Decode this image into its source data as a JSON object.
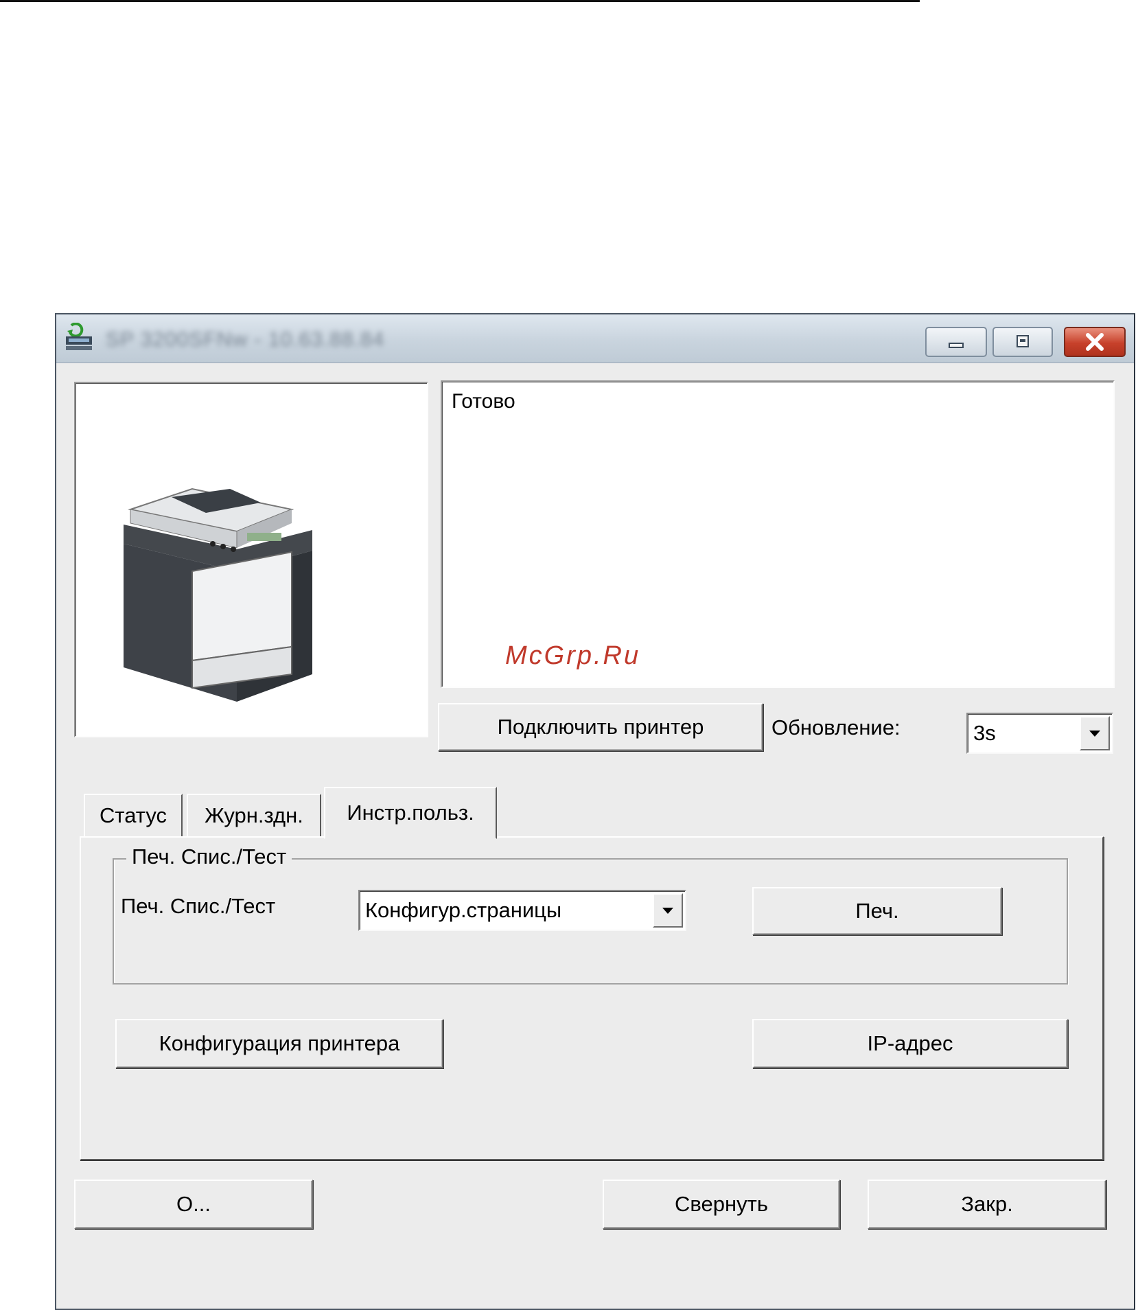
{
  "window": {
    "title": "SP 3200SFNw - 10.63.88.84",
    "title_blurred": true
  },
  "status": {
    "text": "Готово",
    "watermark": "McGrp.Ru"
  },
  "connect_button": "Подключить принтер",
  "update": {
    "label": "Обновление:",
    "value": "3s"
  },
  "tabs": [
    {
      "label": "Статус",
      "active": false
    },
    {
      "label": "Журн.здн.",
      "active": false
    },
    {
      "label": "Инстр.польз.",
      "active": true
    }
  ],
  "print_list_group": {
    "legend": "Печ. Спис./Тест",
    "label": "Печ. Спис./Тест",
    "selected": "Конфигур.страницы",
    "print_button": "Печ."
  },
  "printer_config_button": "Конфигурация принтера",
  "ip_address_button": "IP-адрес",
  "bottom_buttons": {
    "about": "О...",
    "minimize": "Свернуть",
    "close": "Закр."
  },
  "colors": {
    "window_bg": "#ececec",
    "close_button": "#c7412b",
    "watermark": "#c0392b"
  },
  "icons": {
    "app": "printer-status-icon",
    "minimize": "minimize-icon",
    "maximize": "maximize-icon",
    "close": "close-icon",
    "dropdown": "chevron-down-icon"
  }
}
